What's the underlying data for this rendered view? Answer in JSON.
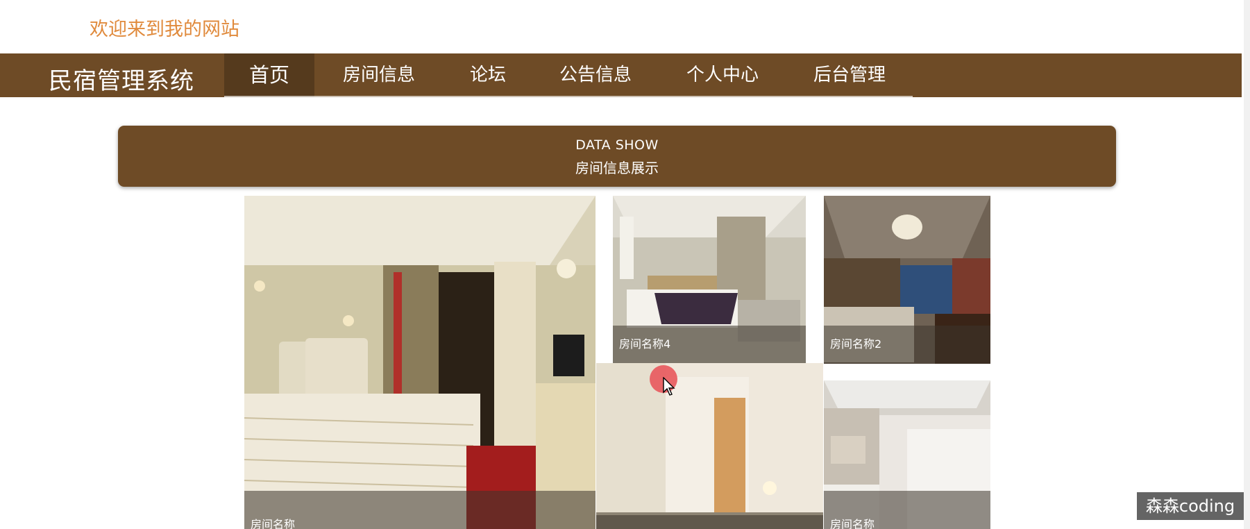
{
  "header": {
    "welcome": "欢迎来到我的网站"
  },
  "nav": {
    "brand": "民宿管理系统",
    "items": [
      {
        "label": "首页",
        "active": true
      },
      {
        "label": "房间信息",
        "active": false
      },
      {
        "label": "论坛",
        "active": false
      },
      {
        "label": "公告信息",
        "active": false
      },
      {
        "label": "个人中心",
        "active": false
      },
      {
        "label": "后台管理",
        "active": false
      }
    ]
  },
  "section": {
    "title_en": "DATA SHOW",
    "title_cn": "房间信息展示"
  },
  "rooms": [
    {
      "name": "房间名称"
    },
    {
      "name": "房间名称4"
    },
    {
      "name": "房间名称2"
    },
    {
      "name": ""
    },
    {
      "name": "房间名称"
    }
  ],
  "watermark": "森森coding",
  "colors": {
    "brand": "#6e4b26",
    "welcome": "#e08a3c"
  }
}
